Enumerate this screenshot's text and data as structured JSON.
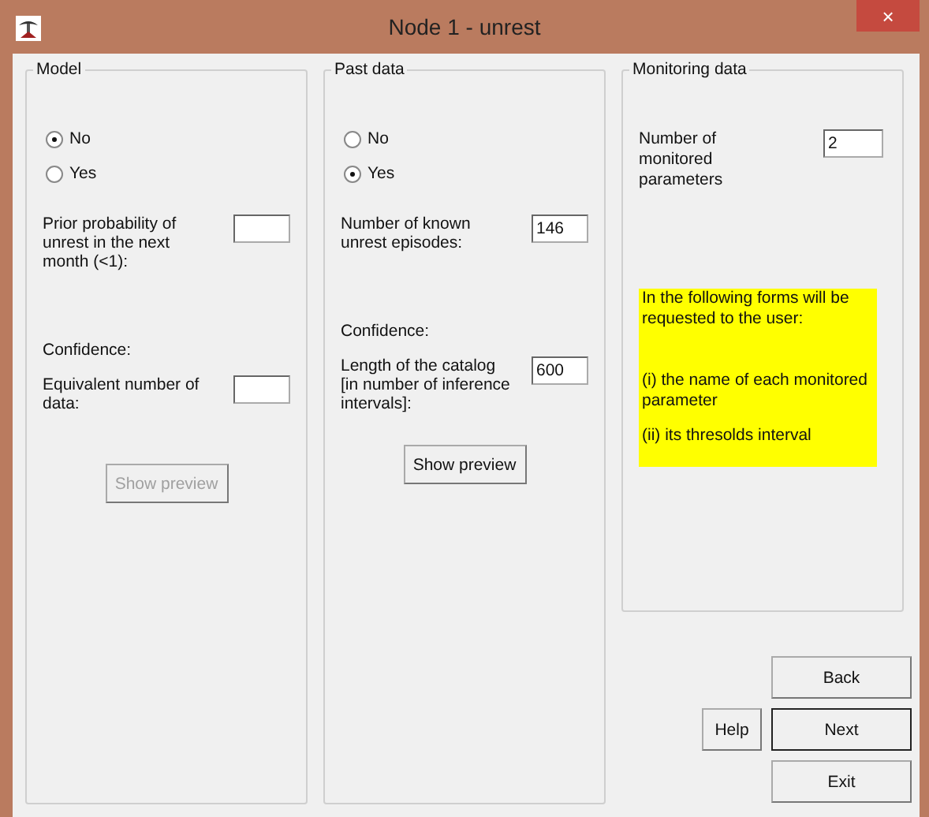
{
  "window": {
    "title": "Node 1 - unrest",
    "close": "×"
  },
  "groups": [
    {
      "title": "Model",
      "options": [
        {
          "label": "No",
          "selected": true
        },
        {
          "label": "Yes",
          "selected": false
        }
      ],
      "first_field": {
        "label": "Prior probability of unrest in the next month (<1):"
      },
      "confidence_label": "Confidence:",
      "second_field": {
        "label": "Equivalent number of data:"
      },
      "preview_button": {
        "label": "Show preview",
        "disabled": true
      }
    },
    {
      "title": "Past data",
      "options": [
        {
          "label": "No",
          "selected": false
        },
        {
          "label": "Yes",
          "selected": true
        }
      ],
      "first_field": {
        "label": "Number of known unrest episodes:",
        "value": "146"
      },
      "confidence_label": "Confidence:",
      "second_field": {
        "label": "Length of the catalog [in number of inference intervals]:",
        "value": "600"
      },
      "preview_button": {
        "label": "Show preview",
        "disabled": false
      }
    }
  ],
  "monitoring": {
    "title": "Monitoring data",
    "field": {
      "label": "Number of monitored parameters",
      "value": "2"
    },
    "note": [
      "In the following forms will be requested to the user:",
      "(i) the name of each monitored parameter",
      "(ii) its thresolds interval"
    ]
  },
  "buttons": [
    {
      "label": "Back",
      "default": false
    },
    {
      "label": "Help",
      "default": false
    },
    {
      "label": "Next",
      "default": true
    },
    {
      "label": "Exit",
      "default": false
    }
  ]
}
